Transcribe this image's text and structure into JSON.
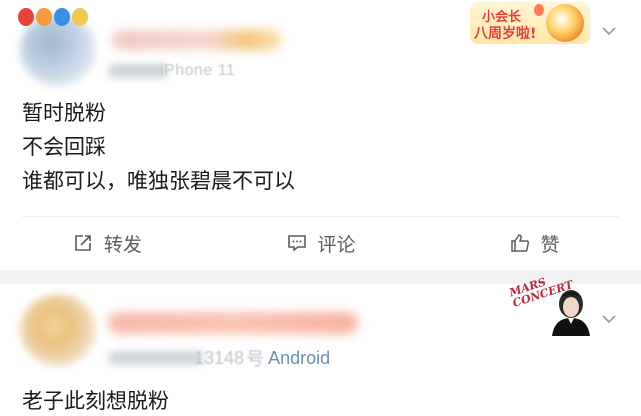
{
  "post1": {
    "device_text": "iPhone 11",
    "badge_line1": "小会长",
    "badge_line2": "八周岁啦!",
    "content_lines": [
      "暂时脱粉",
      "不会回踩",
      "谁都可以，唯独张碧晨不可以"
    ],
    "actions": {
      "repost_label": "转发",
      "comment_label": "评论",
      "like_label": "赞"
    }
  },
  "post2": {
    "time_text": "13148",
    "source_prefix": "号",
    "source_text": "Android",
    "badge_text": "MARS CONCERT",
    "content_lines": [
      "老子此刻想脱粉"
    ]
  },
  "colors": {
    "text": "#1b1b1b",
    "action_text": "#5c5c5c",
    "source_link": "#6d8fb5",
    "separator_band": "#f2f2f2",
    "badge_red": "#e83d2f"
  },
  "icons": [
    "chevron-down-icon",
    "repost-icon",
    "comment-icon",
    "like-icon"
  ]
}
